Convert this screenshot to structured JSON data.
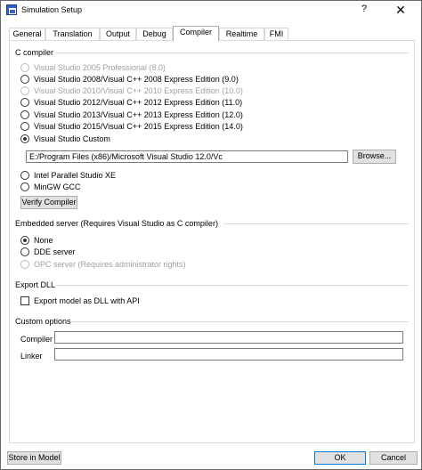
{
  "window": {
    "title": "Simulation Setup",
    "help": "?",
    "close": "✕"
  },
  "tabs": [
    {
      "label": "General",
      "active": false
    },
    {
      "label": "Translation",
      "active": false
    },
    {
      "label": "Output",
      "active": false
    },
    {
      "label": "Debug",
      "active": false
    },
    {
      "label": "Compiler",
      "active": true
    },
    {
      "label": "Realtime",
      "active": false
    },
    {
      "label": "FMI",
      "active": false
    }
  ],
  "compiler": {
    "group_label": "C compiler",
    "options": [
      {
        "label": "Visual Studio 2005 Professional (8.0)",
        "enabled": false,
        "checked": false
      },
      {
        "label": "Visual Studio 2008/Visual C++ 2008 Express Edition (9.0)",
        "enabled": true,
        "checked": false
      },
      {
        "label": "Visual Studio 2010/Visual C++ 2010 Express Edition (10.0)",
        "enabled": false,
        "checked": false
      },
      {
        "label": "Visual Studio 2012/Visual C++ 2012 Express Edition (11.0)",
        "enabled": true,
        "checked": false
      },
      {
        "label": "Visual Studio 2013/Visual C++ 2013 Express Edition (12.0)",
        "enabled": true,
        "checked": false
      },
      {
        "label": "Visual Studio 2015/Visual C++ 2015 Express Edition (14.0)",
        "enabled": true,
        "checked": false
      },
      {
        "label": "Visual Studio Custom",
        "enabled": true,
        "checked": true
      }
    ],
    "custom_path": "E:/Program Files (x86)/Microsoft Visual Studio 12.0/Vc",
    "browse_label": "Browse...",
    "extra_options": [
      {
        "label": "Intel Parallel Studio XE",
        "enabled": true,
        "checked": false
      },
      {
        "label": "MinGW GCC",
        "enabled": true,
        "checked": false
      }
    ],
    "verify_label": "Verify Compiler"
  },
  "embedded": {
    "group_label": "Embedded server (Requires Visual Studio as C compiler)",
    "options": [
      {
        "label": "None",
        "enabled": true,
        "checked": true
      },
      {
        "label": "DDE server",
        "enabled": true,
        "checked": false
      },
      {
        "label": "OPC server (Requires administrator rights)",
        "enabled": false,
        "checked": false
      }
    ]
  },
  "export": {
    "group_label": "Export DLL",
    "checkbox_label": "Export model as DLL with API"
  },
  "custom": {
    "group_label": "Custom options",
    "compiler_label": "Compiler",
    "linker_label": "Linker",
    "compiler_value": "",
    "linker_value": ""
  },
  "footer": {
    "store_label": "Store in Model",
    "ok_label": "OK",
    "cancel_label": "Cancel"
  }
}
